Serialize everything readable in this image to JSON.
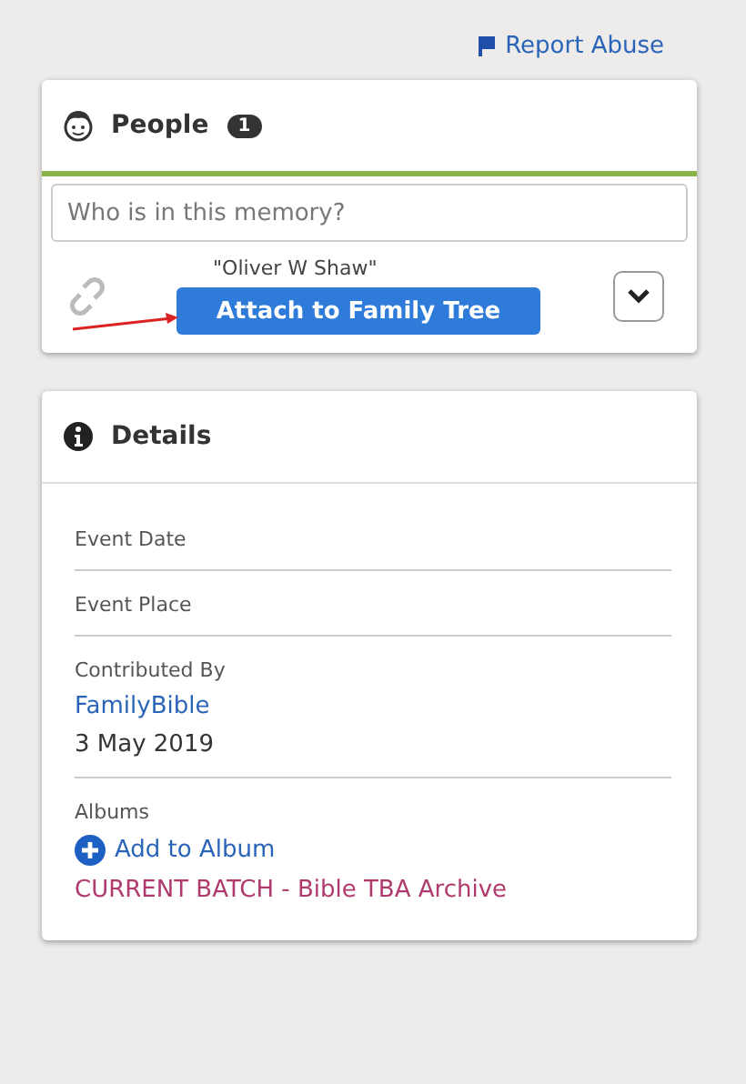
{
  "report_link": {
    "label": "Report Abuse"
  },
  "people": {
    "title": "People",
    "count": "1",
    "search": {
      "placeholder": "Who is in this memory?"
    },
    "persons": [
      {
        "name": "\"Oliver W Shaw\"",
        "action": "Attach to Family Tree",
        "expanded": false
      }
    ]
  },
  "details": {
    "title": "Details",
    "sections": [
      {
        "kind": "label",
        "label": "Event Date"
      },
      {
        "kind": "label",
        "label": "Event Place"
      },
      {
        "kind": "contributor",
        "label": "Contributed By",
        "link": "FamilyBible",
        "date": "3 May 2019"
      },
      {
        "kind": "albums",
        "label": "Albums",
        "add": "Add to Album",
        "albums": [
          "CURRENT BATCH - Bible TBA Archive"
        ]
      }
    ]
  }
}
